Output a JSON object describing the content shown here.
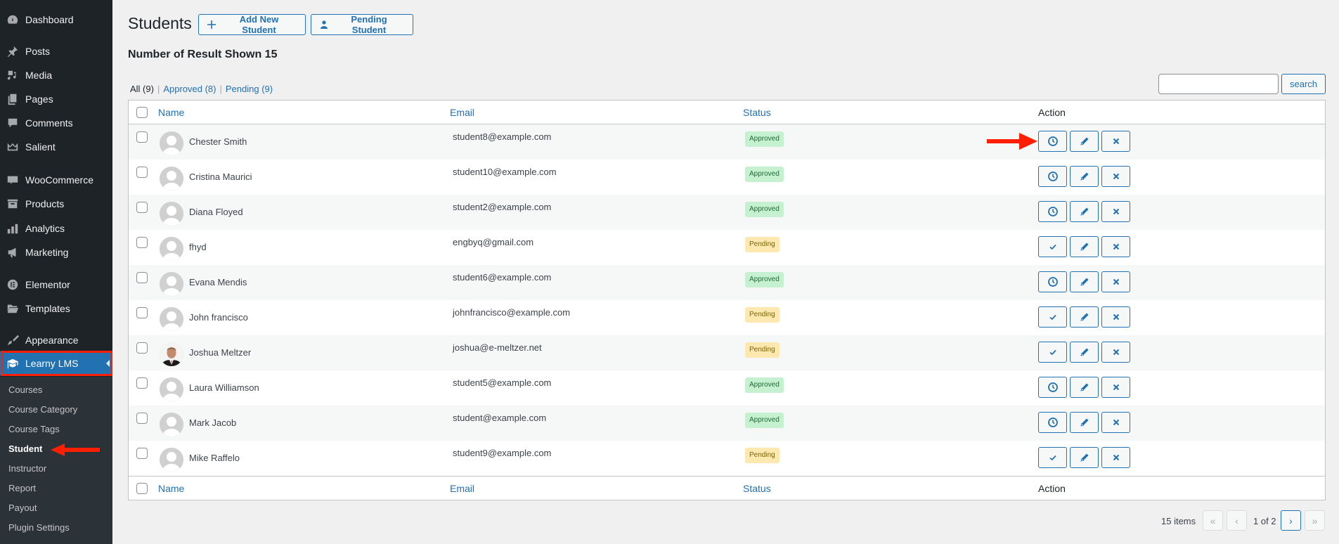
{
  "sidebar": {
    "items": [
      {
        "label": "Dashboard",
        "icon": "dashboard-icon"
      },
      {
        "label": "Posts",
        "icon": "pin-icon"
      },
      {
        "label": "Media",
        "icon": "media-icon"
      },
      {
        "label": "Pages",
        "icon": "pages-icon"
      },
      {
        "label": "Comments",
        "icon": "comment-icon"
      },
      {
        "label": "Salient",
        "icon": "crown-icon"
      },
      {
        "label": "WooCommerce",
        "icon": "woo-icon"
      },
      {
        "label": "Products",
        "icon": "archive-icon"
      },
      {
        "label": "Analytics",
        "icon": "bar-chart-icon"
      },
      {
        "label": "Marketing",
        "icon": "megaphone-icon"
      },
      {
        "label": "Elementor",
        "icon": "elementor-icon"
      },
      {
        "label": "Templates",
        "icon": "folder-icon"
      },
      {
        "label": "Appearance",
        "icon": "paintbrush-icon"
      },
      {
        "label": "Learny LMS",
        "icon": "graduation-cap-icon",
        "active": true
      }
    ],
    "submenu": [
      {
        "label": "Courses"
      },
      {
        "label": "Course Category"
      },
      {
        "label": "Course Tags"
      },
      {
        "label": "Student",
        "current": true
      },
      {
        "label": "Instructor"
      },
      {
        "label": "Report"
      },
      {
        "label": "Payout"
      },
      {
        "label": "Plugin Settings"
      }
    ]
  },
  "header": {
    "title": "Students",
    "add_button": "Add New Student",
    "pending_button": "Pending Student",
    "result_count": "Number of Result Shown 15"
  },
  "filters": {
    "all": "All (9)",
    "approved": "Approved (8)",
    "pending": "Pending (9)",
    "separator": "|"
  },
  "search": {
    "value": "",
    "placeholder": "",
    "button": "search"
  },
  "table": {
    "columns": {
      "name": "Name",
      "email": "Email",
      "status": "Status",
      "action": "Action"
    },
    "rows": [
      {
        "name": "Chester Smith",
        "email": "student8@example.com",
        "status": "Approved",
        "photo": false
      },
      {
        "name": "Cristina Maurici",
        "email": "student10@example.com",
        "status": "Approved",
        "photo": false
      },
      {
        "name": "Diana Floyed",
        "email": "student2@example.com",
        "status": "Approved",
        "photo": false
      },
      {
        "name": "fhyd",
        "email": "engbyq@gmail.com",
        "status": "Pending",
        "photo": false
      },
      {
        "name": "Evana Mendis",
        "email": "student6@example.com",
        "status": "Approved",
        "photo": false
      },
      {
        "name": "John francisco",
        "email": "johnfrancisco@example.com",
        "status": "Pending",
        "photo": false
      },
      {
        "name": "Joshua Meltzer",
        "email": "joshua@e-meltzer.net",
        "status": "Pending",
        "photo": true
      },
      {
        "name": "Laura Williamson",
        "email": "student5@example.com",
        "status": "Approved",
        "photo": false
      },
      {
        "name": "Mark Jacob",
        "email": "student@example.com",
        "status": "Approved",
        "photo": false
      },
      {
        "name": "Mike Raffelo",
        "email": "student9@example.com",
        "status": "Pending",
        "photo": false
      }
    ]
  },
  "pagination": {
    "items": "15 items",
    "first": "«",
    "prev": "‹",
    "page_text": "1 of 2",
    "next": "›",
    "last": "»"
  },
  "colors": {
    "accent": "#2271b1",
    "sidebar_bg": "#1d2327",
    "annotation": "#ff1e00",
    "approved_bg": "#c6f1d0",
    "pending_bg": "#fde9b0"
  }
}
